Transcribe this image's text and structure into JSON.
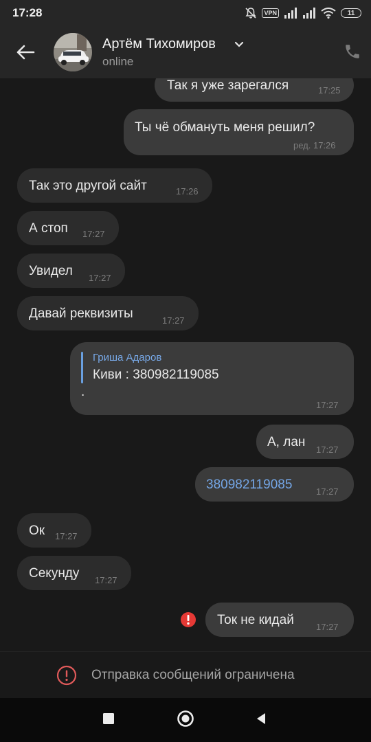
{
  "status_bar": {
    "time": "17:28",
    "vpn": "VPN",
    "battery": "11",
    "icons": [
      "mute-bell-icon",
      "vpn-icon",
      "signal-icon",
      "signal-icon",
      "wifi-icon",
      "battery-icon"
    ]
  },
  "header": {
    "name": "Артём Тихомиров",
    "status": "online",
    "icons": [
      "back-arrow-icon",
      "chevron-down-icon",
      "phone-icon"
    ]
  },
  "messages": [
    {
      "dir": "out",
      "text": "Так я уже зарегался",
      "time": "17:25"
    },
    {
      "dir": "out",
      "text": "Ты чё обмануть меня решил?",
      "time": "ред. 17:26"
    },
    {
      "dir": "in",
      "text": "Так это другой сайт",
      "time": "17:26"
    },
    {
      "dir": "in",
      "text": "А стоп",
      "time": "17:27"
    },
    {
      "dir": "in",
      "text": "Увидел",
      "time": "17:27"
    },
    {
      "dir": "in",
      "text": "Давай реквизиты",
      "time": "17:27"
    },
    {
      "dir": "out",
      "quote_author": "Гриша Адаров",
      "quote_text": "Киви : 380982119085",
      "text": ".",
      "time": "17:27"
    },
    {
      "dir": "out",
      "text": "А, лан",
      "time": "17:27"
    },
    {
      "dir": "out",
      "text": "380982119085",
      "time": "17:27",
      "is_link": true
    },
    {
      "dir": "in",
      "text": "Ок",
      "time": "17:27"
    },
    {
      "dir": "in",
      "text": "Секунду",
      "time": "17:27"
    },
    {
      "dir": "out",
      "text": "Ток не кидай",
      "time": "17:27",
      "failed": true
    }
  ],
  "restriction": {
    "text": "Отправка сообщений ограничена"
  },
  "navbar": {
    "buttons": [
      "recent-apps-button",
      "home-button",
      "back-button"
    ]
  },
  "colors": {
    "background": "#191919",
    "incoming_bubble": "#2c2c2c",
    "outgoing_bubble": "#3b3b3b",
    "link": "#74a6e6",
    "error": "#e53935"
  }
}
